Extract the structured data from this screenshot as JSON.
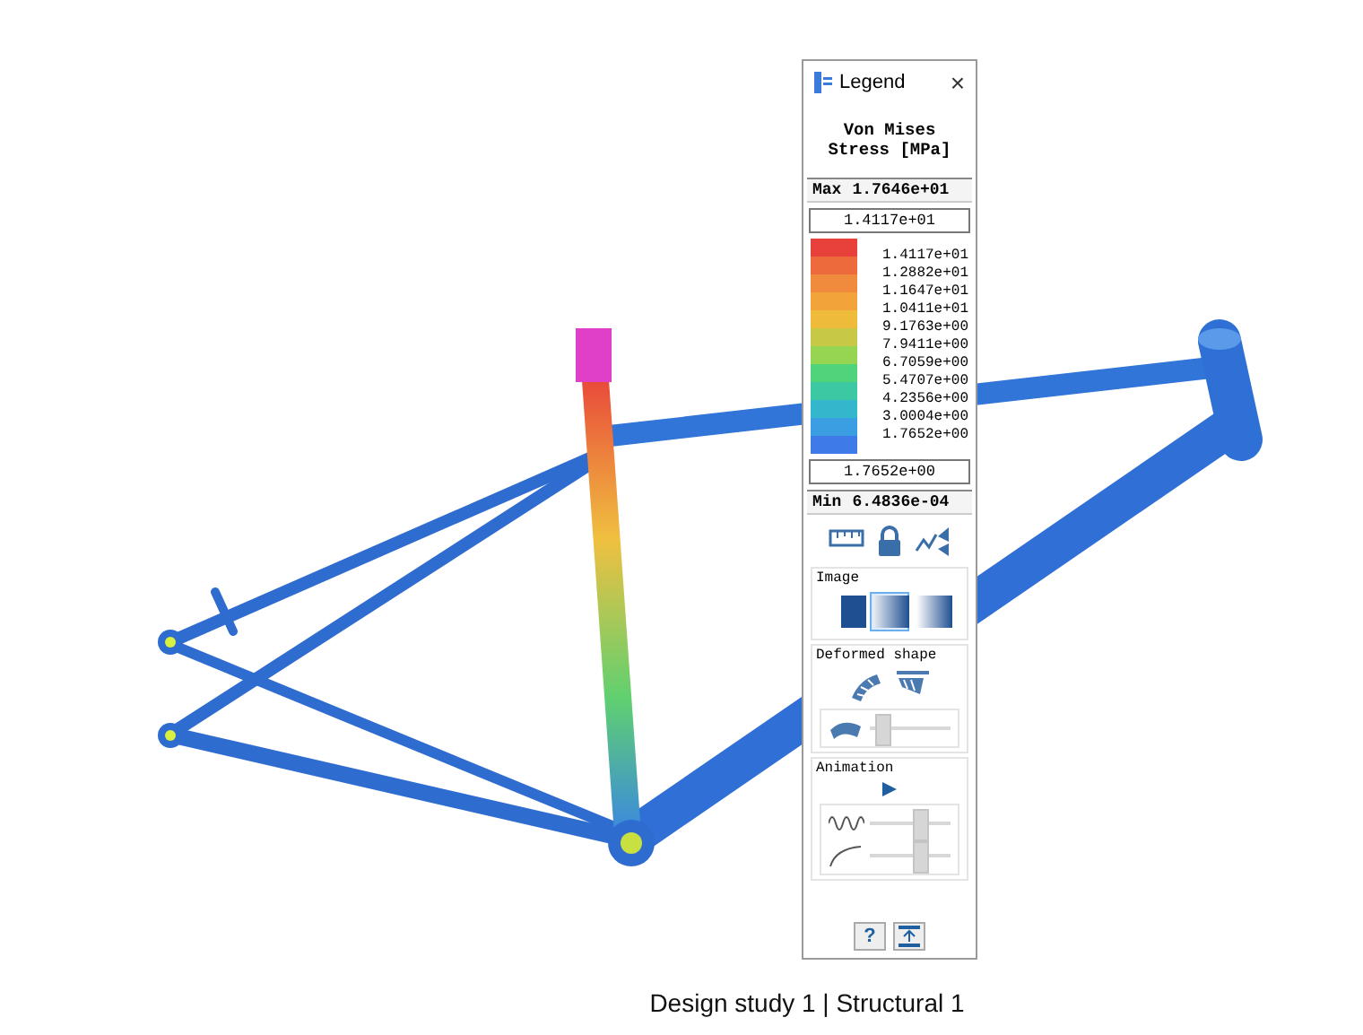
{
  "legend_window": {
    "title": "Legend",
    "close": "×",
    "result_title": "Von Mises\nStress [MPa]",
    "max": {
      "label": "Max",
      "value": "1.7646e+01"
    },
    "upper_field": "1.4117e+01",
    "bands": [
      {
        "color": "#e8403a"
      },
      {
        "color": "#ec6a3c"
      },
      {
        "color": "#f08a3c"
      },
      {
        "color": "#f2a43a"
      },
      {
        "color": "#efbb3a"
      },
      {
        "color": "#c6c846"
      },
      {
        "color": "#96d552"
      },
      {
        "color": "#4fd47c"
      },
      {
        "color": "#3cc8a2"
      },
      {
        "color": "#34b6cc"
      },
      {
        "color": "#3c9ee2"
      },
      {
        "color": "#3e7ae8"
      }
    ],
    "values": [
      "1.4117e+01",
      "1.2882e+01",
      "1.1647e+01",
      "1.0411e+01",
      "9.1763e+00",
      "7.9411e+00",
      "6.7059e+00",
      "5.4707e+00",
      "4.2356e+00",
      "3.0004e+00",
      "1.7652e+00"
    ],
    "lower_field": "1.7652e+00",
    "min": {
      "label": "Min",
      "value": "6.4836e-04"
    },
    "image": {
      "label": "Image",
      "modes": [
        {
          "kind": "dark",
          "selected": false
        },
        {
          "kind": "gradient",
          "selected": true
        },
        {
          "kind": "fade",
          "selected": false
        }
      ]
    },
    "deformed_shape": {
      "label": "Deformed shape",
      "scale": {
        "level": 0.15
      }
    },
    "animation": {
      "label": "Animation",
      "speed": {
        "level": 0.62
      },
      "amplitude": {
        "level": 0.62
      }
    },
    "help_button": "?"
  },
  "caption": "Design study 1 | Structural  1"
}
